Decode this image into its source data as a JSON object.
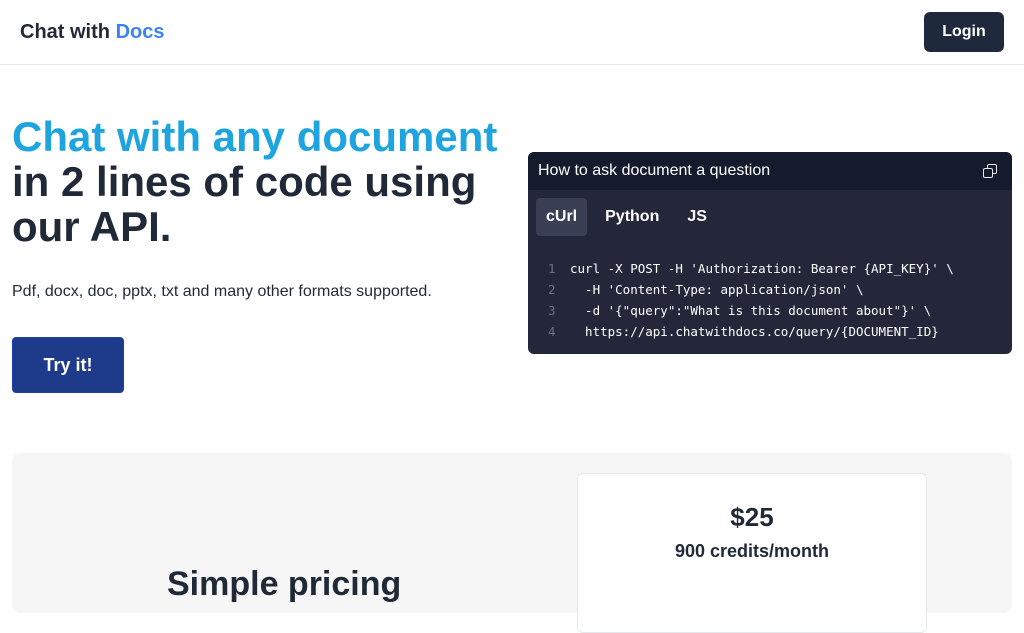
{
  "header": {
    "brand_prefix": "Chat with",
    "brand_accent": "Docs",
    "login_label": "Login"
  },
  "hero": {
    "title_line1": "Chat with any document",
    "title_line2": "in 2 lines of code using",
    "title_line3": "our API.",
    "subtitle": "Pdf, docx, doc, pptx, txt and many other formats supported.",
    "cta_label": "Try it!"
  },
  "code_card": {
    "title": "How to ask document a question",
    "copy_icon": "copy-icon",
    "tabs": [
      {
        "label": "cUrl",
        "active": true
      },
      {
        "label": "Python",
        "active": false
      },
      {
        "label": "JS",
        "active": false
      }
    ],
    "lines": [
      {
        "num": "1",
        "text": "curl -X POST -H 'Authorization: Bearer {API_KEY}' \\"
      },
      {
        "num": "2",
        "text": "  -H 'Content-Type: application/json' \\"
      },
      {
        "num": "3",
        "text": "  -d '{\"query\":\"What is this document about\"}' \\"
      },
      {
        "num": "4",
        "text": "  https://api.chatwithdocs.co/query/{DOCUMENT_ID}"
      }
    ]
  },
  "pricing": {
    "heading": "Simple pricing",
    "price": "$25",
    "credits": "900 credits/month"
  },
  "colors": {
    "accent_blue": "#3b82f6",
    "hero_blue": "#1ea5e0",
    "button_dark": "#1e2a3b",
    "cta_blue": "#1e3a8a",
    "code_bg": "#24273a"
  }
}
